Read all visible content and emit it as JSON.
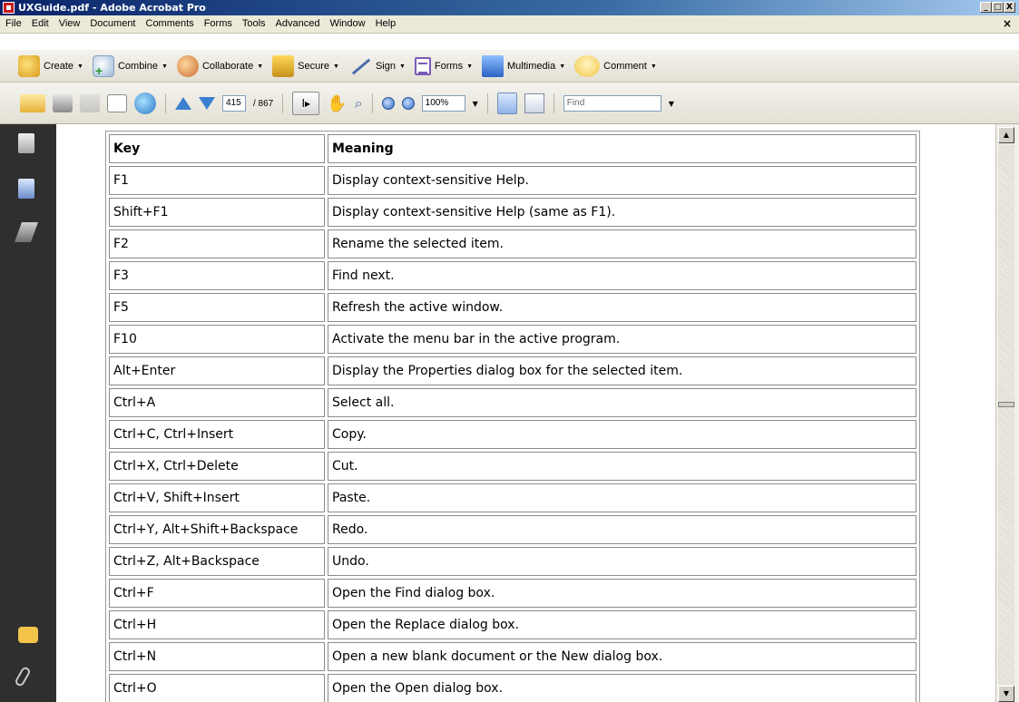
{
  "window": {
    "title": "UXGuide.pdf - Adobe Acrobat Pro",
    "controls": [
      "_",
      "□",
      "X"
    ]
  },
  "menubar": {
    "items": [
      "File",
      "Edit",
      "View",
      "Document",
      "Comments",
      "Forms",
      "Tools",
      "Advanced",
      "Window",
      "Help"
    ],
    "close_doc": "×"
  },
  "toolbar1": {
    "buttons": [
      "Create",
      "Combine",
      "Collaborate",
      "Secure",
      "Sign",
      "Forms",
      "Multimedia",
      "Comment"
    ]
  },
  "toolbar2": {
    "page_current": "415",
    "page_total": "/ 867",
    "zoom": "100%",
    "find_placeholder": "Find"
  },
  "table": {
    "headers": [
      "Key",
      "Meaning"
    ],
    "rows": [
      [
        "F1",
        "Display context-sensitive Help."
      ],
      [
        "Shift+F1",
        "Display context-sensitive Help (same as F1)."
      ],
      [
        "F2",
        "Rename the selected item."
      ],
      [
        "F3",
        "Find next."
      ],
      [
        "F5",
        "Refresh the active window."
      ],
      [
        "F10",
        "Activate the menu bar in the active program."
      ],
      [
        "Alt+Enter",
        "Display the Properties dialog box for the selected item."
      ],
      [
        "Ctrl+A",
        "Select all."
      ],
      [
        "Ctrl+C, Ctrl+Insert",
        "Copy."
      ],
      [
        "Ctrl+X, Ctrl+Delete",
        "Cut."
      ],
      [
        "Ctrl+V, Shift+Insert",
        "Paste."
      ],
      [
        "Ctrl+Y, Alt+Shift+Backspace",
        "Redo."
      ],
      [
        "Ctrl+Z, Alt+Backspace",
        "Undo."
      ],
      [
        "Ctrl+F",
        "Open the Find dialog box."
      ],
      [
        "Ctrl+H",
        "Open the Replace dialog box."
      ],
      [
        "Ctrl+N",
        "Open a new blank document or the New dialog box."
      ],
      [
        "Ctrl+O",
        "Open the Open dialog box."
      ]
    ]
  },
  "icons": {
    "nav": [
      "pages-icon",
      "bookmarks-icon",
      "signatures-icon",
      "comments-icon",
      "attachments-icon"
    ]
  }
}
